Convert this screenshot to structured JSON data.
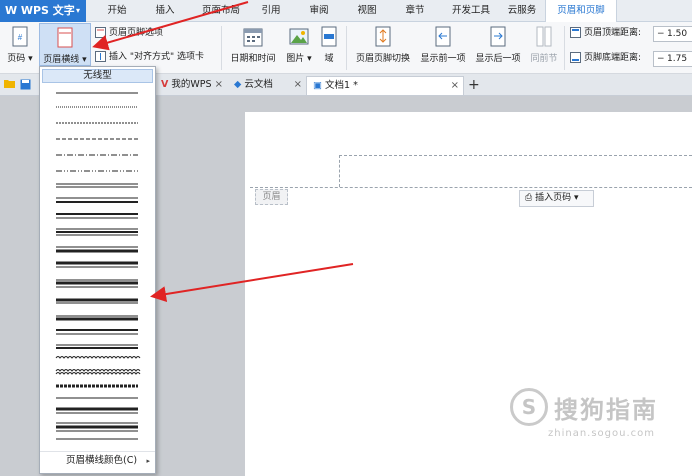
{
  "app": {
    "name": "WPS 文字"
  },
  "menubar": {
    "tabs": [
      "开始",
      "插入",
      "页面布局",
      "引用",
      "审阅",
      "视图",
      "章节",
      "开发工具",
      "云服务",
      "页眉和页脚"
    ],
    "active": "页眉和页脚"
  },
  "ribbon": {
    "page_num": "页码",
    "header_line": "页眉横线",
    "header_footer_options": "页眉页脚选项",
    "insert_align_tab": "插入 \"对齐方式\" 选项卡",
    "date_time": "日期和时间",
    "picture": "图片",
    "field": "域",
    "switch_header_footer": "页眉页脚切换",
    "show_prev": "显示前一项",
    "show_next": "显示后一项",
    "same_as_prev": "同前节",
    "header_top_distance_label": "页眉顶端距离:",
    "header_top_distance_value": "1.50",
    "footer_bottom_distance_label": "页脚底端距离:",
    "footer_bottom_distance_value": "1.75"
  },
  "doc_tabs": [
    {
      "label": "我的WPS",
      "close": "×"
    },
    {
      "label": "云文档",
      "close": "×"
    },
    {
      "label": "文档1 *",
      "close": "×"
    }
  ],
  "new_tab": "+",
  "dropdown": {
    "none_label": "无线型",
    "color_label": "页眉横线颜色(C)"
  },
  "document": {
    "header_label": "页眉",
    "insert_page_number": "插入页码"
  },
  "watermark": {
    "text": "搜狗指南",
    "url": "zhinan.sogou.com"
  },
  "colors": {
    "accent": "#2a78d2",
    "arrow": "#e02424"
  }
}
